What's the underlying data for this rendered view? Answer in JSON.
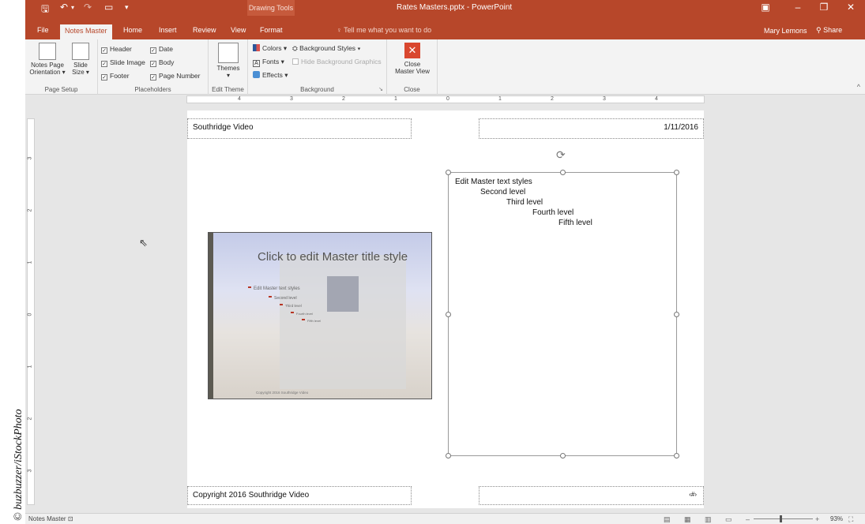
{
  "credit": "© buzbuzzer/iStockPhoto",
  "window": {
    "title": "Rates Masters.pptx - PowerPoint",
    "context_tab": "Drawing Tools",
    "user": "Mary Lemons",
    "share": "Share",
    "tell_me": "Tell me what you want to do"
  },
  "tabs": [
    "File",
    "Notes Master",
    "Home",
    "Insert",
    "Review",
    "View",
    "Format"
  ],
  "active_tab": "Notes Master",
  "ribbon": {
    "page_setup": {
      "notes_page_orientation_line1": "Notes Page",
      "notes_page_orientation_line2": "Orientation ▾",
      "slide_size_line1": "Slide",
      "slide_size_line2": "Size ▾",
      "label": "Page Setup"
    },
    "placeholders": {
      "header": "Header",
      "slide_image": "Slide Image",
      "footer": "Footer",
      "date": "Date",
      "body": "Body",
      "page_number": "Page Number",
      "label": "Placeholders"
    },
    "edit_theme": {
      "themes": "Themes",
      "label": "Edit Theme"
    },
    "background": {
      "colors": "Colors ▾",
      "fonts": "Fonts ▾",
      "effects": "Effects ▾",
      "background_styles": "Background Styles ▾",
      "hide_background_graphics": "Hide Background Graphics",
      "label": "Background"
    },
    "close": {
      "close_line1": "Close",
      "close_line2": "Master View",
      "label": "Close"
    }
  },
  "ruler": {
    "numbers": [
      "4",
      "3",
      "2",
      "1",
      "0",
      "1",
      "2",
      "3",
      "4"
    ],
    "vertical_numbers": [
      "3",
      "2",
      "1",
      "0",
      "1",
      "2",
      "3"
    ]
  },
  "page": {
    "header": "Southridge Video",
    "date": "1/11/2016",
    "footer": "Copyright 2016 Southridge Video",
    "page_number": "‹#›",
    "slide": {
      "title": "Click to edit Master title style",
      "levels": [
        "Edit Master text styles",
        "Second level",
        "Third level",
        "Fourth level",
        "Fifth level"
      ],
      "copyright": "Copyright 2016 Southridge Video"
    },
    "notes_levels": [
      "Edit Master text styles",
      "Second level",
      "Third level",
      "Fourth level",
      "Fifth level"
    ]
  },
  "status": {
    "view": "Notes Master",
    "zoom": "93%"
  },
  "colors": {
    "brand": "#b7472a",
    "ribbon": "#f3f3f3",
    "canvas": "#e6e6e6"
  }
}
